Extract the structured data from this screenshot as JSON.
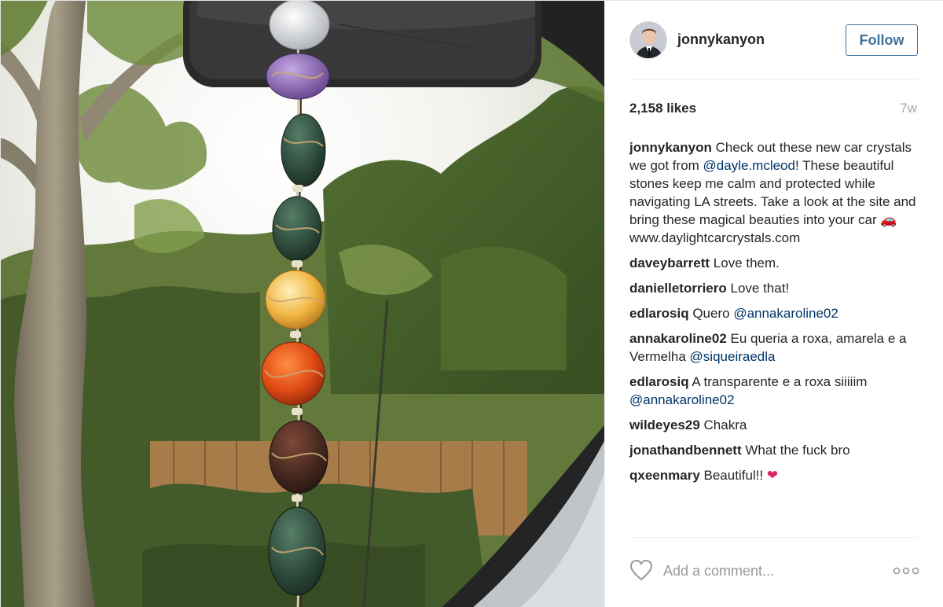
{
  "post": {
    "author": "jonnykanyon",
    "follow_label": "Follow",
    "likes": "2,158 likes",
    "time_ago": "7w",
    "caption": {
      "user": "jonnykanyon",
      "text_1": " Check out these new car crystals we got from ",
      "mention": "@dayle.mcleod",
      "text_2": "! These beautiful stones keep me calm and protected while navigating LA streets. Take a look at the site and bring these magical beauties into your car ",
      "emoji": "🚗",
      "url": "www.daylightcarcrystals.com"
    },
    "comments": [
      {
        "user": "daveybarrett",
        "text": "Love them."
      },
      {
        "user": "danielletorriero",
        "text": "Love that!"
      },
      {
        "user": "edlarosiq",
        "text": "Quero ",
        "mention": "@annakaroline02"
      },
      {
        "user": "annakaroline02",
        "text": "Eu queria a roxa, amarela e a Vermelha ",
        "mention": "@siqueiraedla"
      },
      {
        "user": "edlarosiq",
        "text": "A transparente e a roxa siiiiim ",
        "mention": "@annakaroline02"
      },
      {
        "user": "wildeyes29",
        "text": "Chakra"
      },
      {
        "user": "jonathandbennett",
        "text": "What the fuck bro"
      },
      {
        "user": "qxeenmary",
        "text": "Beautiful!! ",
        "emoji": "❤"
      }
    ],
    "add_comment_placeholder": "Add a comment...",
    "icons": {
      "like": "heart-outline-icon",
      "more": "more-options-icon"
    },
    "colors": {
      "follow_border": "#3f729b",
      "mention": "#003569",
      "muted": "#999999"
    }
  }
}
